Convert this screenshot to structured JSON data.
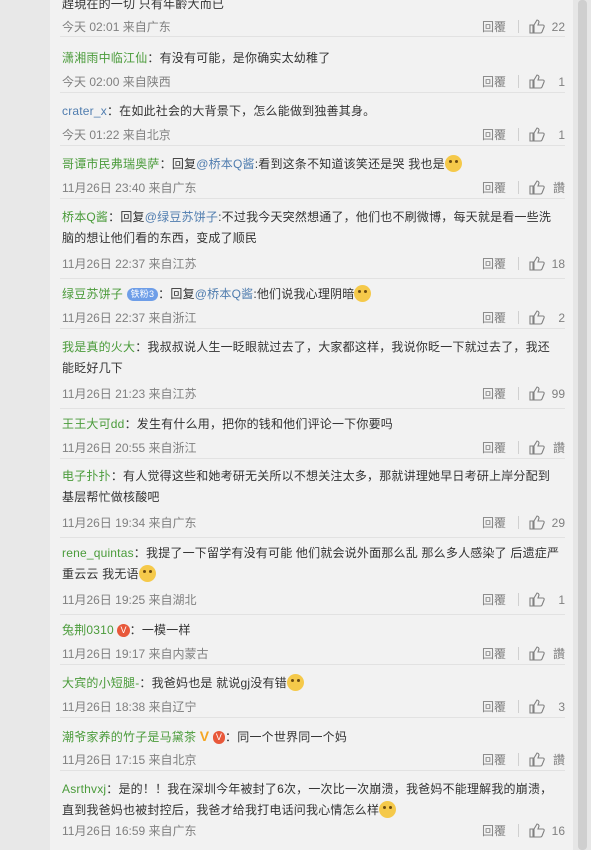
{
  "labels": {
    "reply": "回覆"
  },
  "comments": [
    {
      "user": "",
      "text": "趕現在的一切 只有年齡大而已",
      "time": "今天 02:01 来自广东",
      "likes": "22"
    },
    {
      "user": "潇湘雨中临江仙",
      "text": "有没有可能，是你确实太幼稚了",
      "time": "今天 02:00 来自陕西",
      "likes": "1"
    },
    {
      "user": "crater_x",
      "text": "在如此社会的大背景下，怎么能做到独善其身。",
      "time": "今天 01:22 来自北京",
      "likes": "1"
    },
    {
      "user": "哥谭市民弗瑞奥萨",
      "prefix": "回复",
      "mention": "@桥本Q酱",
      "text": ":看到这条不知道该笑还是哭 我也是",
      "emoji": "sweat-smile-emoji",
      "time": "11月26日 23:40 来自广东",
      "likes": "讚"
    },
    {
      "user": "桥本Q酱",
      "prefix": "回复",
      "mention": "@绿豆苏饼子",
      "text": ":不过我今天突然想通了，他们也不刷微博，每天就是看一些洗脑的想让他们看的东西，变成了顺民",
      "time": "11月26日 22:37 来自江苏",
      "likes": "18"
    },
    {
      "user": "绿豆苏饼子",
      "badge": "铁粉3",
      "prefix": "回复",
      "mention": "@桥本Q酱",
      "text": ":他们说我心理阴暗",
      "emoji": "cry-emoji",
      "time": "11月26日 22:37 来自浙江",
      "likes": "2"
    },
    {
      "user": "我是真的火大",
      "text": "我叔叔说人生一眨眼就过去了，大家都这样，我说你眨一下就过去了，我还能眨好几下",
      "time": "11月26日 21:23 来自江苏",
      "likes": "99"
    },
    {
      "user": "王王大可dd",
      "text": "发生有什么用，把你的钱和他们评论一下你要吗",
      "time": "11月26日 20:55 来自浙江",
      "likes": "讚"
    },
    {
      "user": "电子扑扑",
      "text": "有人觉得这些和她考研无关所以不想关注太多，那就讲理她早日考研上岸分配到基层帮忙做核酸吧",
      "time": "11月26日 19:34 来自广东",
      "likes": "29"
    },
    {
      "user": "rene_quintas",
      "text": "我提了一下留学有没有可能 他们就会说外面那么乱 那么多人感染了 后遗症严重云云 我无语",
      "emoji": "shrug-emoji",
      "time": "11月26日 19:25 来自湖北",
      "likes": "1"
    },
    {
      "user": "兔荆0310",
      "badge2": "V",
      "text": "一模一样",
      "time": "11月26日 19:17 来自内蒙古",
      "likes": "讚"
    },
    {
      "user": "大宾的小短腿-",
      "text": "我爸妈也是 就说gj没有错",
      "emoji": "dog-emoji",
      "time": "11月26日 18:38 来自辽宁",
      "likes": "3"
    },
    {
      "user": "潮爷家养的竹子是马黛茶",
      "vip": "V",
      "badge2": "V",
      "text": "同一个世界同一个妈",
      "time": "11月26日 17:15 来自北京",
      "likes": "讚"
    },
    {
      "user": "Asrthvxj",
      "text": "是的！！我在深圳今年被封了6次，一次比一次崩溃，我爸妈不能理解我的崩溃，直到我爸妈也被封控后，我爸才给我打电话问我心情怎么样",
      "emoji": "sad-emoji",
      "time": "11月26日 16:59 来自广东",
      "likes": "16"
    }
  ]
}
